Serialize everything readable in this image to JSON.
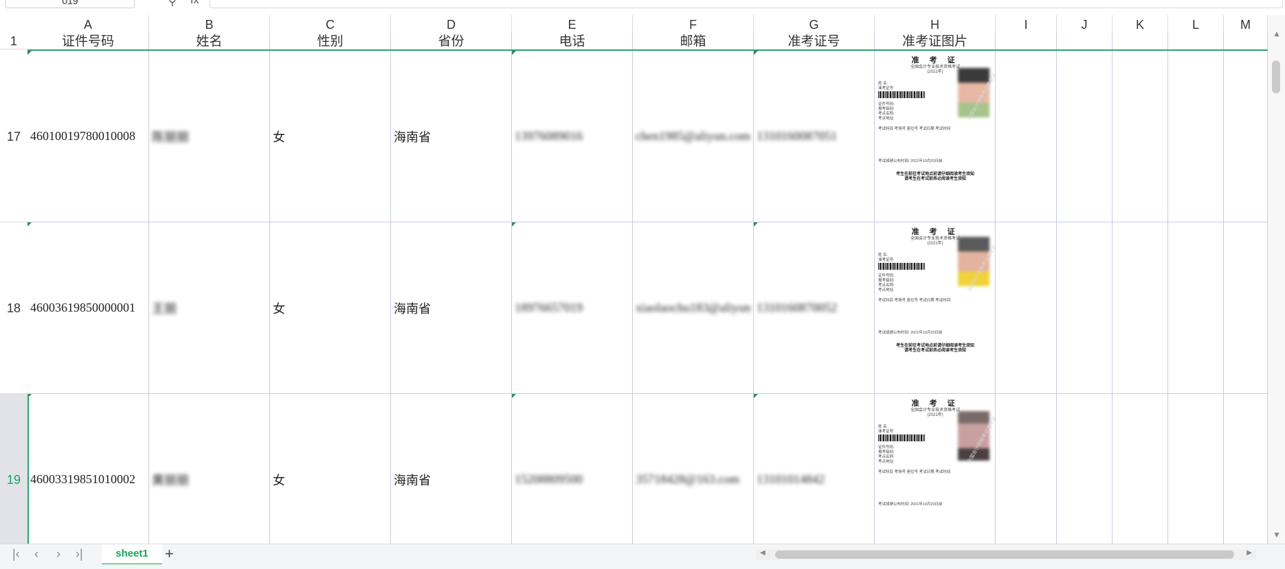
{
  "formula_bar": {
    "cell_ref": "019",
    "fx_label": "fx"
  },
  "columns": [
    "A",
    "B",
    "C",
    "D",
    "E",
    "F",
    "G",
    "H",
    "I",
    "J",
    "K",
    "L",
    "M"
  ],
  "header_row_number": "1",
  "header_labels": [
    "证件号码",
    "姓名",
    "性别",
    "省份",
    "电话",
    "邮箱",
    "准考证号",
    "准考证图片"
  ],
  "rows": [
    {
      "num": "17",
      "id": "46010019780010008",
      "name": "陈丽丽",
      "gender": "女",
      "province": "海南省",
      "phone": "13976089016",
      "email": "chen1985@aliyun.com",
      "ticket": "1310160087051"
    },
    {
      "num": "18",
      "id": "46003619850000001",
      "name": "王丽",
      "gender": "女",
      "province": "海南省",
      "phone": "18976657019",
      "email": "xiaolaochu183@aliyun",
      "ticket": "1310160870052"
    },
    {
      "num": "19",
      "id": "46003319851010002",
      "name": "黄丽丽",
      "gender": "女",
      "province": "海南省",
      "phone": "15208809500",
      "email": "35718428@163.com",
      "ticket": "13101014842"
    }
  ],
  "ticket_image": {
    "title": "准 考 证",
    "subtitle": "全国会计专业技术资格考试",
    "year": "(2021年)",
    "notice": "考生在前往考试地点前请仔细阅读考生须知",
    "notice2": "请考生在考试前务必阅读考生须知",
    "fields": [
      "姓 名:",
      "准考证号:",
      "证件号码:",
      "报考级别:",
      "考点名称:",
      "考点地址:"
    ],
    "exam_header": "考试科目  考场号  座位号  考试日期  考试时间",
    "footer": "考试成绩公布时间: 2021年10月20日前",
    "watermark": "全国会计资格考试准考证"
  },
  "sheet_tab": "sheet1",
  "nav_icons": [
    "first-sheet-icon",
    "prev-sheet-icon",
    "next-sheet-icon",
    "last-sheet-icon"
  ]
}
